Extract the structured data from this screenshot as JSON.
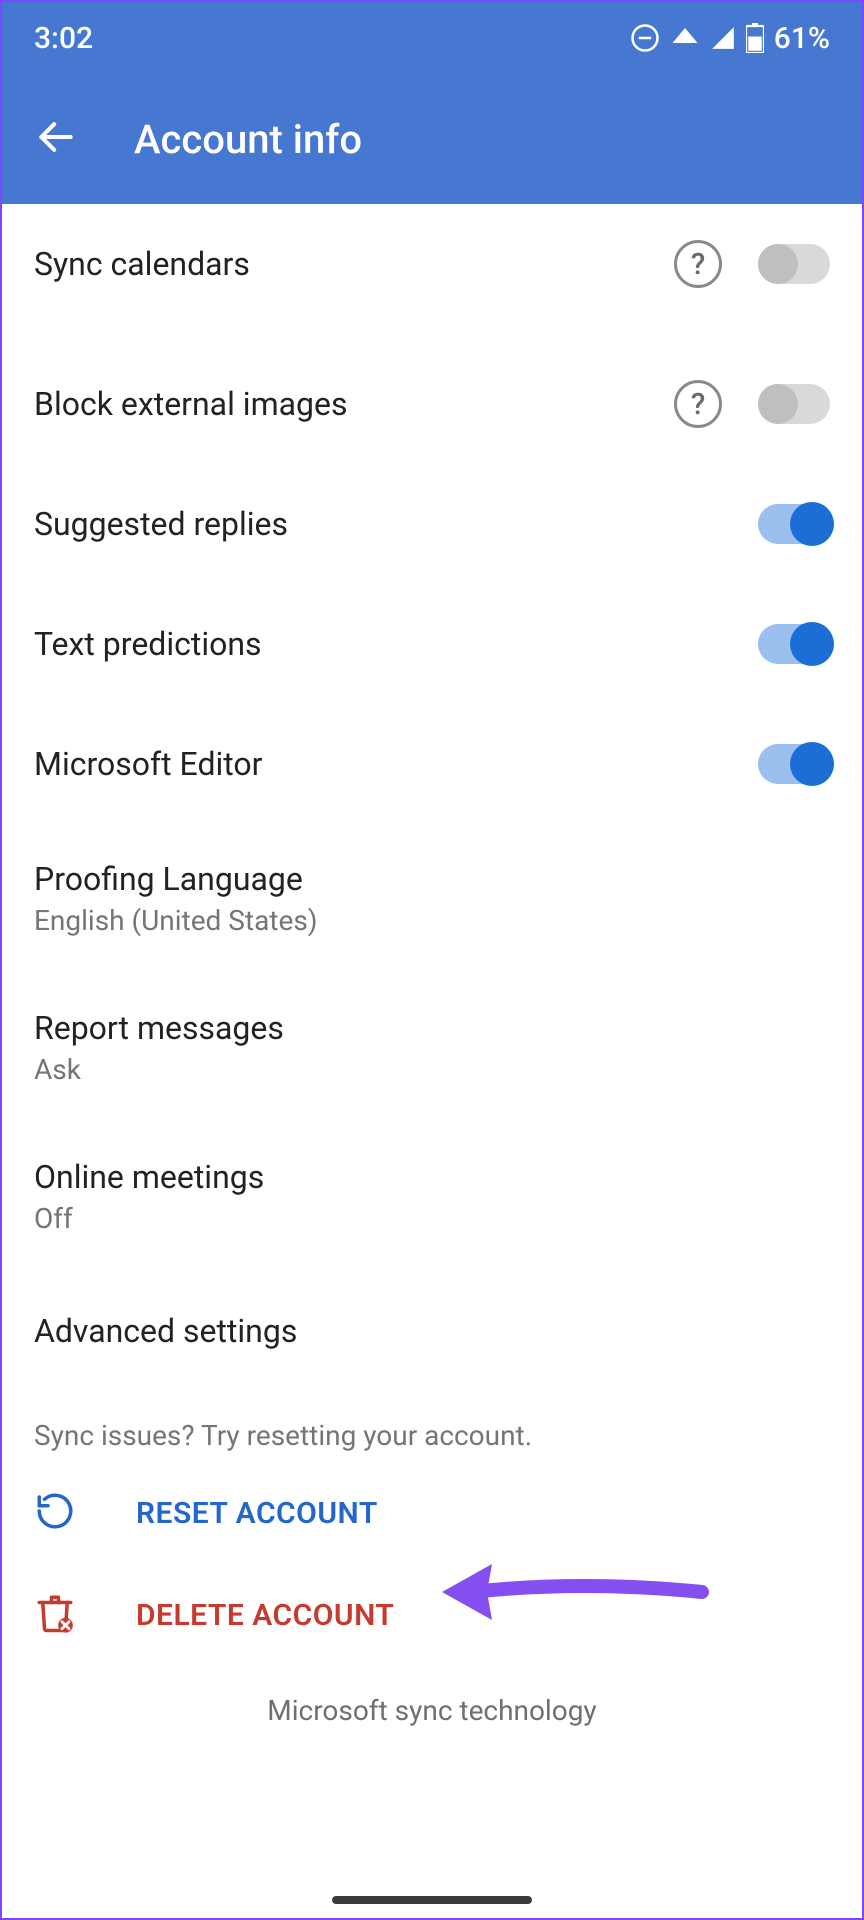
{
  "status": {
    "time": "3:02",
    "battery_pct": "61%"
  },
  "header": {
    "title": "Account info"
  },
  "settings": {
    "sync_calendars": {
      "label": "Sync calendars",
      "on": false,
      "help": true
    },
    "block_external": {
      "label": "Block external images",
      "on": false,
      "help": true
    },
    "suggested_replies": {
      "label": "Suggested replies",
      "on": true
    },
    "text_predictions": {
      "label": "Text predictions",
      "on": true
    },
    "microsoft_editor": {
      "label": "Microsoft Editor",
      "on": true
    },
    "proofing_language": {
      "label": "Proofing Language",
      "value": "English (United States)"
    },
    "report_messages": {
      "label": "Report messages",
      "value": "Ask"
    },
    "online_meetings": {
      "label": "Online meetings",
      "value": "Off"
    },
    "advanced": {
      "label": "Advanced settings"
    }
  },
  "hint": "Sync issues? Try resetting your account.",
  "actions": {
    "reset": {
      "label": "RESET ACCOUNT"
    },
    "delete": {
      "label": "DELETE ACCOUNT"
    }
  },
  "footer": "Microsoft sync technology",
  "colors": {
    "accent": "#4678d1",
    "primary_text": "#212121",
    "secondary_text": "#757575",
    "danger": "#c63b2e",
    "link": "#2467c9",
    "annotation": "#854ff0"
  }
}
